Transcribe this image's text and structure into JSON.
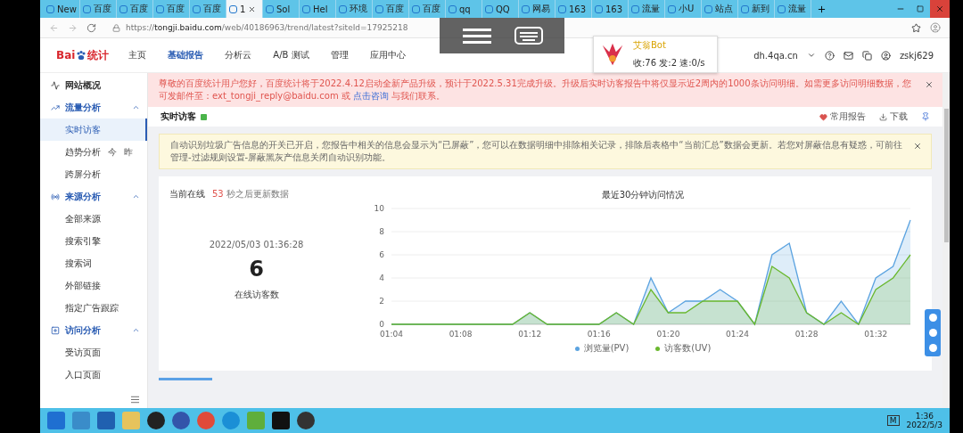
{
  "browser": {
    "tabs": [
      {
        "label": "New",
        "selected": false
      },
      {
        "label": "百度",
        "selected": false
      },
      {
        "label": "百度",
        "selected": false
      },
      {
        "label": "百度",
        "selected": false
      },
      {
        "label": "百度",
        "selected": false
      },
      {
        "label": "1",
        "selected": true
      },
      {
        "label": "Sol",
        "selected": false
      },
      {
        "label": "Hel",
        "selected": false
      },
      {
        "label": "环境",
        "selected": false
      },
      {
        "label": "百度",
        "selected": false
      },
      {
        "label": "百度",
        "selected": false
      },
      {
        "label": "qq",
        "selected": false
      },
      {
        "label": "QQ",
        "selected": false
      },
      {
        "label": "网易",
        "selected": false
      },
      {
        "label": "163",
        "selected": false
      },
      {
        "label": "163",
        "selected": false
      },
      {
        "label": "流量",
        "selected": false
      },
      {
        "label": "小U",
        "selected": false
      },
      {
        "label": "站点",
        "selected": false
      },
      {
        "label": "新到",
        "selected": false
      },
      {
        "label": "流量",
        "selected": false
      }
    ],
    "address_host": "tongji.baidu.com",
    "address_scheme": "https://",
    "address_path": "/web/40186963/trend/latest?siteId=17925218"
  },
  "notification": {
    "title": "艾翁Bot",
    "stats": "收:76 发:2 速:0/s"
  },
  "header": {
    "logo_prefix": "Bai",
    "logo_suffix": "统计",
    "nav": [
      {
        "label": "主页",
        "selected": false
      },
      {
        "label": "基础报告",
        "selected": true
      },
      {
        "label": "分析云",
        "selected": false
      },
      {
        "label": "A/B 测试",
        "selected": false
      },
      {
        "label": "管理",
        "selected": false
      },
      {
        "label": "应用中心",
        "selected": false
      }
    ],
    "site": "dh.4qa.cn",
    "user": "zskj629"
  },
  "sidebar": {
    "items": [
      {
        "label": "网站概况",
        "kind": "link"
      },
      {
        "label": "流量分析",
        "kind": "group",
        "expanded": true,
        "children": [
          {
            "label": "实时访客",
            "selected": true
          },
          {
            "label": "趋势分析",
            "selected": false,
            "extras": [
              "今",
              "昨"
            ]
          },
          {
            "label": "跨屏分析",
            "selected": false
          }
        ]
      },
      {
        "label": "来源分析",
        "kind": "group",
        "expanded": true,
        "children": [
          {
            "label": "全部来源",
            "selected": false
          },
          {
            "label": "搜索引擎",
            "selected": false
          },
          {
            "label": "搜索词",
            "selected": false
          },
          {
            "label": "外部链接",
            "selected": false
          },
          {
            "label": "指定广告跟踪",
            "selected": false
          }
        ]
      },
      {
        "label": "访问分析",
        "kind": "group",
        "expanded": true,
        "children": [
          {
            "label": "受访页面",
            "selected": false
          },
          {
            "label": "入口页面",
            "selected": false
          }
        ]
      }
    ]
  },
  "alert": {
    "before": "尊敬的百度统计用户您好，百度统计将于2022.4.12启动全新产品升级，预计于2022.5.31完成升级。升级后实时访客报告中将仅显示近2周内的1000条访问明细。如需更多访问明细数据，您可发邮件至：ext_tongji_reply@baidu.com 或 ",
    "link": "点击咨询",
    "after": " 与我们联系。"
  },
  "page": {
    "title": "实时访客",
    "actions": [
      {
        "label": "常用报告",
        "kind": "favorite"
      },
      {
        "label": "下载",
        "kind": "download"
      }
    ]
  },
  "notice": "自动识别垃圾广告信息的开关已开启，您报告中相关的信息会显示为“已屏蔽”，您可以在数据明细中排除相关记录，排除后表格中“当前汇总”数据会更新。若您对屏蔽信息有疑惑，可前往管理-过滤规则设置-屏蔽黑灰产信息关闭自动识别功能。",
  "online": {
    "label": "当前在线",
    "countdown": "53",
    "countdown_suffix": "秒之后更新数据",
    "time": "2022/05/03 01:36:28",
    "count": "6",
    "count_label": "在线访客数"
  },
  "chart": {
    "chart_data": {
      "type": "area",
      "title": "最近30分钟访问情况",
      "grid": true,
      "categories": [
        "01:04",
        null,
        null,
        null,
        "01:08",
        null,
        null,
        null,
        "01:12",
        null,
        null,
        null,
        "01:16",
        null,
        null,
        null,
        "01:20",
        null,
        null,
        null,
        "01:24",
        null,
        null,
        null,
        "01:28",
        null,
        null,
        null,
        "01:32",
        null,
        null
      ],
      "ylim": [
        0,
        10
      ],
      "yticks": [
        0,
        2,
        4,
        6,
        8,
        10
      ],
      "series": [
        {
          "name": "浏览量(PV)",
          "color": "#5ba3e0",
          "values": [
            0,
            0,
            0,
            0,
            0,
            0,
            0,
            0,
            1,
            0,
            0,
            0,
            0,
            1,
            0,
            4,
            1,
            2,
            2,
            3,
            2,
            0,
            6,
            7,
            1,
            0,
            2,
            0,
            4,
            5,
            9
          ]
        },
        {
          "name": "访客数(UV)",
          "color": "#6ab82e",
          "values": [
            0,
            0,
            0,
            0,
            0,
            0,
            0,
            0,
            1,
            0,
            0,
            0,
            0,
            1,
            0,
            3,
            1,
            1,
            2,
            2,
            2,
            0,
            5,
            4,
            1,
            0,
            1,
            0,
            3,
            4,
            6
          ]
        }
      ]
    }
  },
  "taskbar": {
    "ime": "M",
    "time": "1:36",
    "date": "2022/5/3"
  }
}
